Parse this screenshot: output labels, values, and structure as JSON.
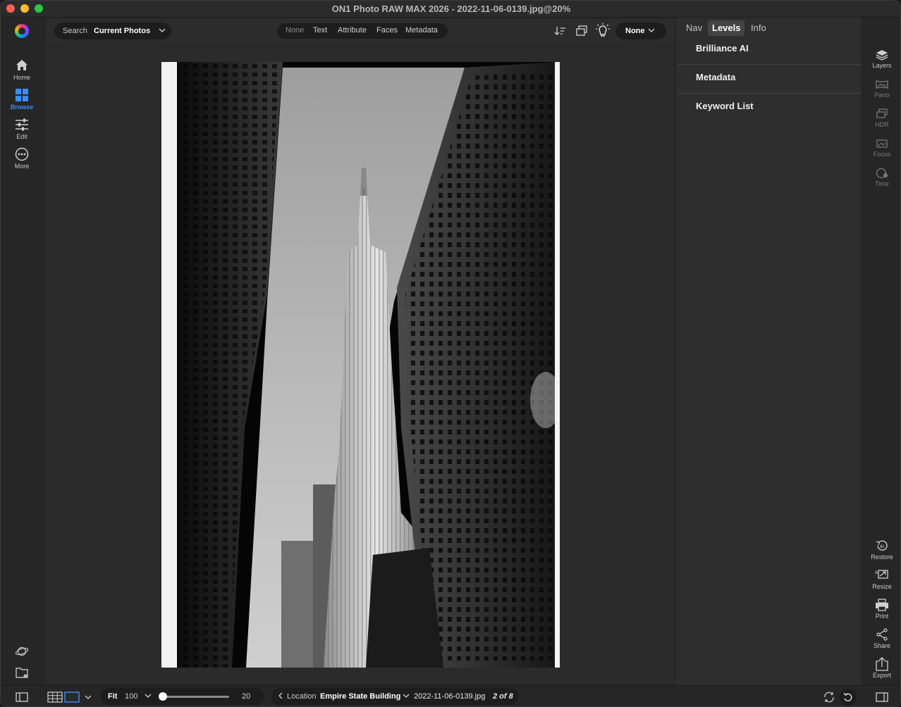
{
  "window": {
    "title": "ON1 Photo RAW MAX 2026 - 2022-11-06-0139.jpg@20%"
  },
  "left_nav": {
    "items": [
      {
        "label": "Home",
        "icon": "home-icon",
        "active": false
      },
      {
        "label": "Browse",
        "icon": "grid-icon",
        "active": true
      },
      {
        "label": "Edit",
        "icon": "sliders-icon",
        "active": false
      },
      {
        "label": "More",
        "icon": "more-icon",
        "active": false
      }
    ],
    "bottom_icons": [
      "planet-icon",
      "folder-heart-icon",
      "sidebar-toggle-icon"
    ]
  },
  "toolbar": {
    "search_label": "Search",
    "search_scope": "Current Photos",
    "filters": [
      "None",
      "Text",
      "Attribute",
      "Faces",
      "Metadata"
    ],
    "right_icons": [
      "sort-icon",
      "stack-icon",
      "lightbulb-icon"
    ],
    "grouping_value": "None"
  },
  "photo": {
    "description_icon": "photo-image",
    "caption": "Empire State Building"
  },
  "right_panel": {
    "tabs": [
      {
        "label": "Nav",
        "active": false
      },
      {
        "label": "Levels",
        "active": true
      },
      {
        "label": "Info",
        "active": false
      }
    ],
    "sections": [
      "Brilliance AI",
      "Metadata",
      "Keyword List"
    ]
  },
  "right_rail": {
    "top": [
      {
        "label": "Layers",
        "icon": "layers-icon",
        "enabled": true
      },
      {
        "label": "Pano",
        "icon": "pano-icon",
        "enabled": false
      },
      {
        "label": "HDR",
        "icon": "hdr-icon",
        "enabled": false
      },
      {
        "label": "Focus",
        "icon": "focus-icon",
        "enabled": false
      },
      {
        "label": "Time",
        "icon": "time-icon",
        "enabled": false
      }
    ],
    "bottom": [
      {
        "label": "Restore",
        "icon": "restore-icon"
      },
      {
        "label": "Resize",
        "icon": "resize-icon"
      },
      {
        "label": "Print",
        "icon": "print-icon"
      },
      {
        "label": "Share",
        "icon": "share-icon"
      },
      {
        "label": "Export",
        "icon": "export-icon"
      }
    ]
  },
  "bottom_bar": {
    "zoom_mode": "Fit",
    "zoom_value": "100",
    "thumb_size": "20",
    "thumb_size_fraction": 0.0,
    "location_label": "Location",
    "location_value": "Empire State Building",
    "filename": "2022-11-06-0139.jpg",
    "position": "2 of 8"
  },
  "colors": {
    "accent": "#3a8df8",
    "panel": "#2e2e2e",
    "pill": "#1d1d1d"
  }
}
